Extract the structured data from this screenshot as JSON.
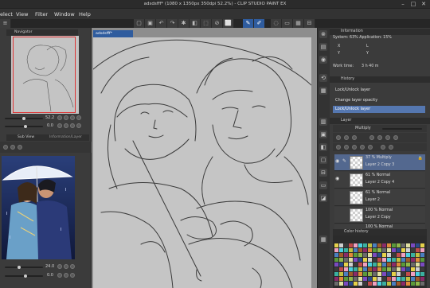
{
  "window": {
    "title": "adsdsfff* (1080 x 1350px 350dpi 52.2%) - CLIP STUDIO PAINT EX"
  },
  "menu": {
    "items": [
      "elect",
      "View",
      "Filter",
      "Window",
      "Help"
    ]
  },
  "left_panel": {
    "navigator_tab": "Navigator",
    "zoom_value": "52.2",
    "angle_value": "0.0",
    "subview_tab": "Sub View",
    "subview_tab2": "Information/Layer",
    "sub_zoom": "24.0",
    "sub_angle": "0.0"
  },
  "canvas": {
    "tab": "adsdsfff*"
  },
  "right_panel": {
    "info_tab": "Information",
    "system_line": "System: 63% Application: 15%",
    "xl": "X",
    "yl": "Y",
    "lx": "L",
    "ly": "Y",
    "worktime_label": "Work time:",
    "worktime_value": "3 h 40 m",
    "history_tab": "History",
    "history": [
      {
        "label": "Lock/Unlock layer",
        "selected": false
      },
      {
        "label": "Change layer opacity",
        "selected": false
      },
      {
        "label": "Lock/Unlock layer",
        "selected": true
      }
    ],
    "layer_tab": "Layer",
    "blend_mode": "Multiply",
    "layers": [
      {
        "blend": "37 % Multiply",
        "name": "Layer 2 Copy 3",
        "selected": true,
        "visible": true
      },
      {
        "blend": "61 % Normal",
        "name": "Layer 2 Copy 4",
        "selected": false,
        "visible": true
      },
      {
        "blend": "61 % Normal",
        "name": "Layer 2",
        "selected": false,
        "visible": false
      },
      {
        "blend": "100 % Normal",
        "name": "Layer 2 Copy",
        "selected": false,
        "visible": false
      },
      {
        "blend": "100 % Normal",
        "name": "Layer 8",
        "selected": false,
        "visible": false
      }
    ],
    "last_layer_blend": "100 % Normal",
    "color_history_tab": "Color history"
  },
  "icons": [
    "menu-icon",
    "navigator-icon",
    "undo-icon",
    "redo-icon",
    "pen-icon",
    "eraser-icon",
    "lasso-icon",
    "camera-icon",
    "layer-icon",
    "eye-icon",
    "lock-icon",
    "settings-icon",
    "minimize-icon",
    "maximize-icon",
    "close-icon",
    "palette-icon"
  ],
  "colors": {
    "accent": "#2f5c9e",
    "selection": "#53688f",
    "history_sel": "#5577b0",
    "nav_frame": "#dd3333"
  }
}
